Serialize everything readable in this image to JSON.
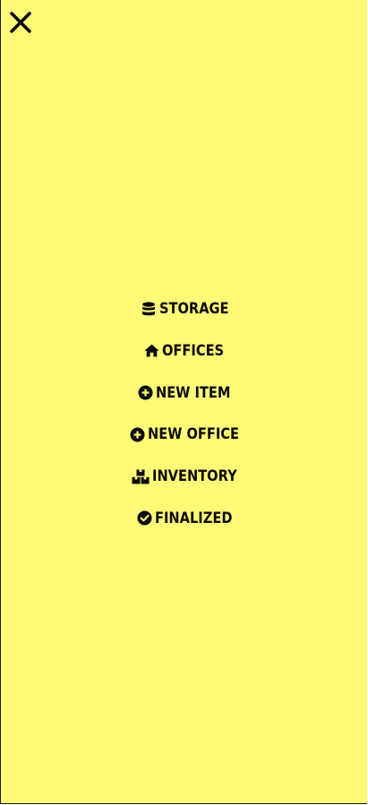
{
  "colors": {
    "drawer_background": "#fffb77",
    "text": "#0a0a0a"
  },
  "close": {
    "icon": "close-icon"
  },
  "menu": {
    "items": [
      {
        "label": "STORAGE",
        "icon": "database-icon"
      },
      {
        "label": "OFFICES",
        "icon": "home-icon"
      },
      {
        "label": "NEW ITEM",
        "icon": "plus-circle-icon"
      },
      {
        "label": "NEW OFFICE",
        "icon": "plus-circle-icon"
      },
      {
        "label": "INVENTORY",
        "icon": "boxes-icon"
      },
      {
        "label": "FINALIZED",
        "icon": "check-circle-icon"
      }
    ]
  }
}
